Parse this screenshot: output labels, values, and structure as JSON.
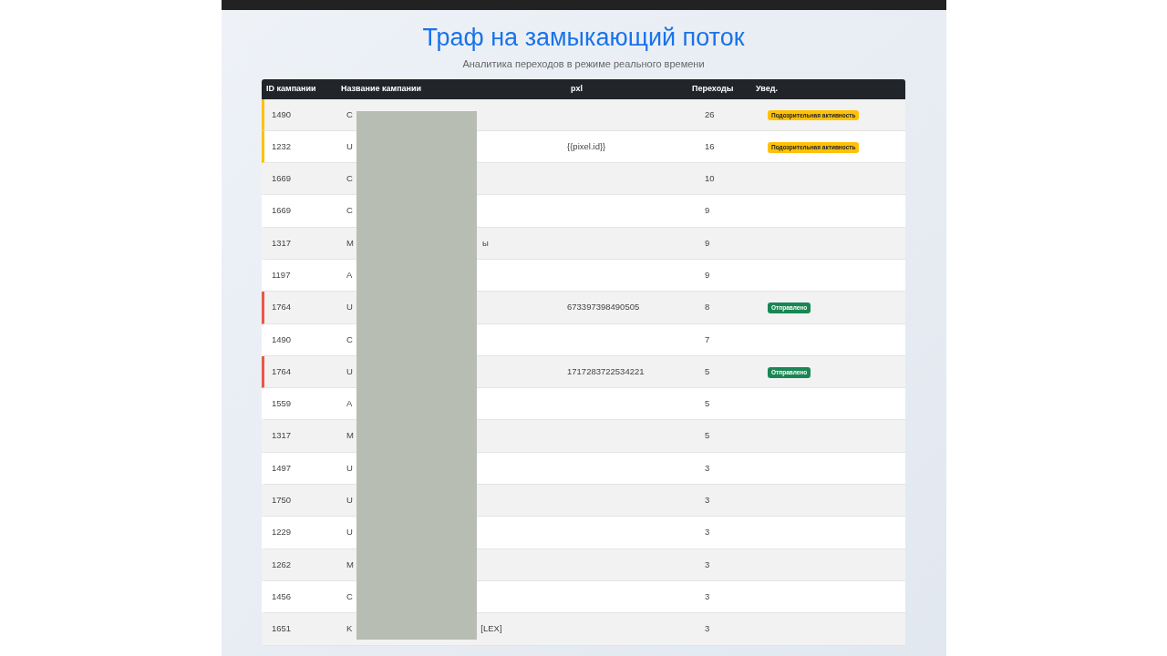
{
  "title": "Траф на замыкающий поток",
  "subtitle": "Аналитика переходов в режиме реального времени",
  "table": {
    "columns": [
      "ID кампании",
      "Название кампании",
      "pxl",
      "Переходы",
      "Увед."
    ],
    "rows": [
      {
        "id": "1490",
        "name_start": "C",
        "pxl": "",
        "clicks": "26",
        "badge": {
          "text": "Подозрительная активность",
          "kind": "warning"
        }
      },
      {
        "id": "1232",
        "name_start": "U",
        "pxl": "{{pixel.id}}",
        "clicks": "16",
        "badge": {
          "text": "Подозрительная активность",
          "kind": "warning"
        }
      },
      {
        "id": "1669",
        "name_start": "C",
        "pxl": "",
        "clicks": "10"
      },
      {
        "id": "1669",
        "name_start": "C",
        "pxl": "",
        "clicks": "9"
      },
      {
        "id": "1317",
        "name_start": "M",
        "name_end": "ы",
        "pxl": "",
        "clicks": "9"
      },
      {
        "id": "1197",
        "name_start": "A",
        "pxl": "",
        "clicks": "9"
      },
      {
        "id": "1764",
        "name_start": "U",
        "pxl": "673397398490505",
        "clicks": "8",
        "badge": {
          "text": "Отправлено",
          "kind": "sent"
        }
      },
      {
        "id": "1490",
        "name_start": "C",
        "pxl": "",
        "clicks": "7"
      },
      {
        "id": "1764",
        "name_start": "U",
        "pxl": "1717283722534221",
        "clicks": "5",
        "badge": {
          "text": "Отправлено",
          "kind": "sent"
        }
      },
      {
        "id": "1559",
        "name_start": "A",
        "pxl": "",
        "clicks": "5"
      },
      {
        "id": "1317",
        "name_start": "M",
        "pxl": "",
        "clicks": "5"
      },
      {
        "id": "1497",
        "name_start": "U",
        "pxl": "",
        "clicks": "3"
      },
      {
        "id": "1750",
        "name_start": "U",
        "pxl": "",
        "clicks": "3"
      },
      {
        "id": "1229",
        "name_start": "U",
        "pxl": "",
        "clicks": "3"
      },
      {
        "id": "1262",
        "name_start": "M",
        "pxl": "",
        "clicks": "3"
      },
      {
        "id": "1456",
        "name_start": "C",
        "pxl": "",
        "clicks": "3"
      },
      {
        "id": "1651",
        "name_start": "K",
        "name_end": "[LEX]",
        "pxl": "",
        "clicks": "3"
      }
    ]
  }
}
